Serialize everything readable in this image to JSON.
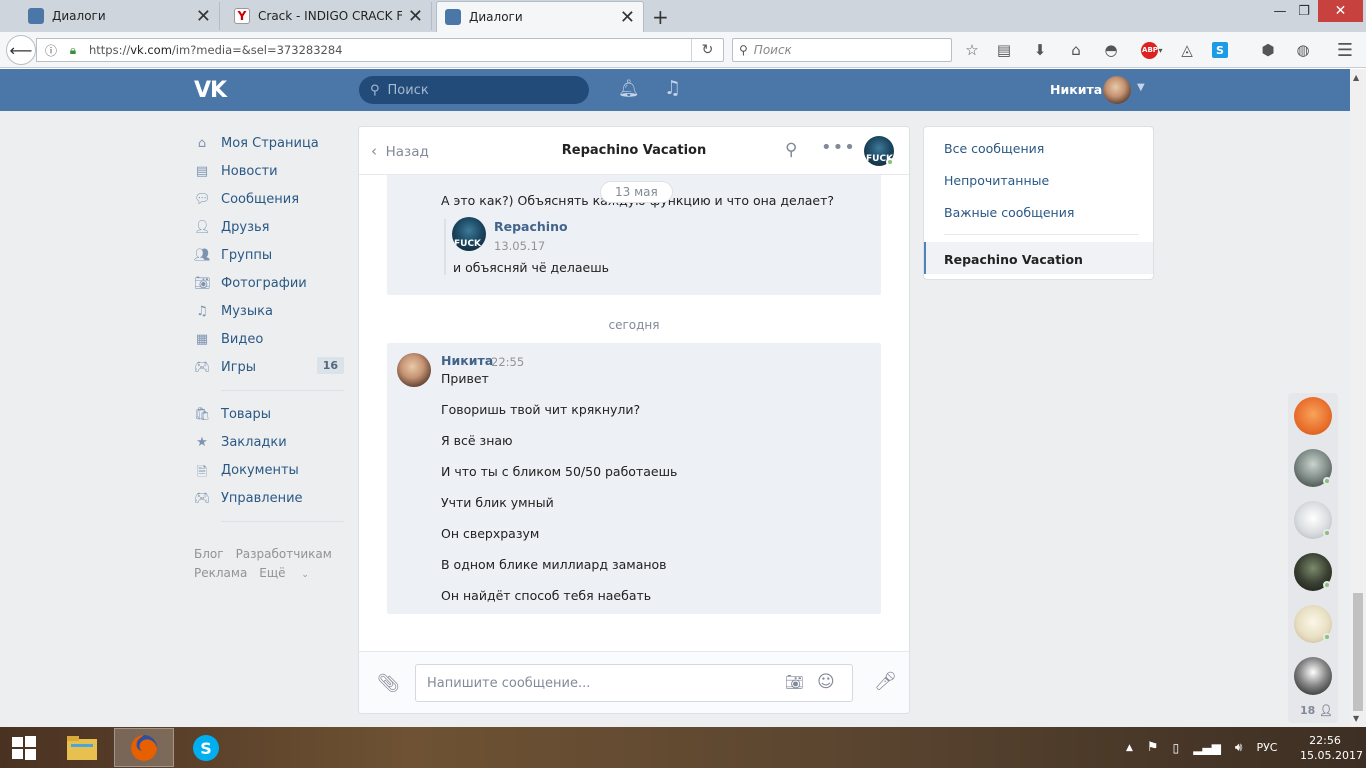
{
  "browser": {
    "tabs": [
      {
        "label": "Диалоги",
        "active": false
      },
      {
        "label": "Crack - INDIGO CRACK FREE",
        "active": false
      },
      {
        "label": "Диалоги",
        "active": true
      }
    ],
    "url_prefix": "https://",
    "url_host": "vk.com",
    "url_path": "/im?media=&sel=373283284",
    "search_placeholder": "Поиск",
    "adblock_label": "ABP"
  },
  "vk_header": {
    "logo": "VK",
    "search_placeholder": "Поиск",
    "user_name": "Никита"
  },
  "left_nav": {
    "items": [
      {
        "label": "Моя Страница",
        "icon": "home-icon"
      },
      {
        "label": "Новости",
        "icon": "news-icon"
      },
      {
        "label": "Сообщения",
        "icon": "messages-icon"
      },
      {
        "label": "Друзья",
        "icon": "friends-icon"
      },
      {
        "label": "Группы",
        "icon": "groups-icon"
      },
      {
        "label": "Фотографии",
        "icon": "photos-icon"
      },
      {
        "label": "Музыка",
        "icon": "music-icon"
      },
      {
        "label": "Видео",
        "icon": "video-icon"
      },
      {
        "label": "Игры",
        "icon": "games-icon",
        "count": "16"
      }
    ],
    "items2": [
      {
        "label": "Товары",
        "icon": "market-icon"
      },
      {
        "label": "Закладки",
        "icon": "bookmarks-icon"
      },
      {
        "label": "Документы",
        "icon": "documents-icon"
      },
      {
        "label": "Управление",
        "icon": "manage-icon"
      }
    ],
    "footer": {
      "blog": "Блог",
      "developers": "Разработчикам",
      "ads": "Реклама",
      "more": "Ещё"
    }
  },
  "chat": {
    "back_label": "Назад",
    "title": "Repachino Vacation",
    "date_pill": "13 мая",
    "earlier_message": "А это как?) Объяснять каждую функцию и что она делает?",
    "forwarded": {
      "author": "Repachino",
      "date": "13.05.17",
      "text": "и объясняй чё делаешь",
      "avatar_text": "FUCK"
    },
    "today_label": "сегодня",
    "current": {
      "author": "Никита",
      "time": "22:55",
      "messages": [
        "Привет",
        "Говоришь твой чит крякнули?",
        "Я всё знаю",
        "И что ты с бликом 50/50 работаешь",
        "Учти блик умный",
        "Он сверхразум",
        "В одном блике миллиард заманов",
        "Он найдёт способ тебя наебать"
      ]
    },
    "input_placeholder": "Напишите сообщение..."
  },
  "right_menu": {
    "all": "Все сообщения",
    "unread": "Непрочитанные",
    "important": "Важные сообщения",
    "active_chat": "Repachino Vacation"
  },
  "fast_chat": {
    "count": "18"
  },
  "taskbar": {
    "language": "РУС",
    "time": "22:56",
    "date": "15.05.2017"
  },
  "colors": {
    "vk_blue": "#4a76a8",
    "link": "#2a5885",
    "online": "#8ac176"
  }
}
